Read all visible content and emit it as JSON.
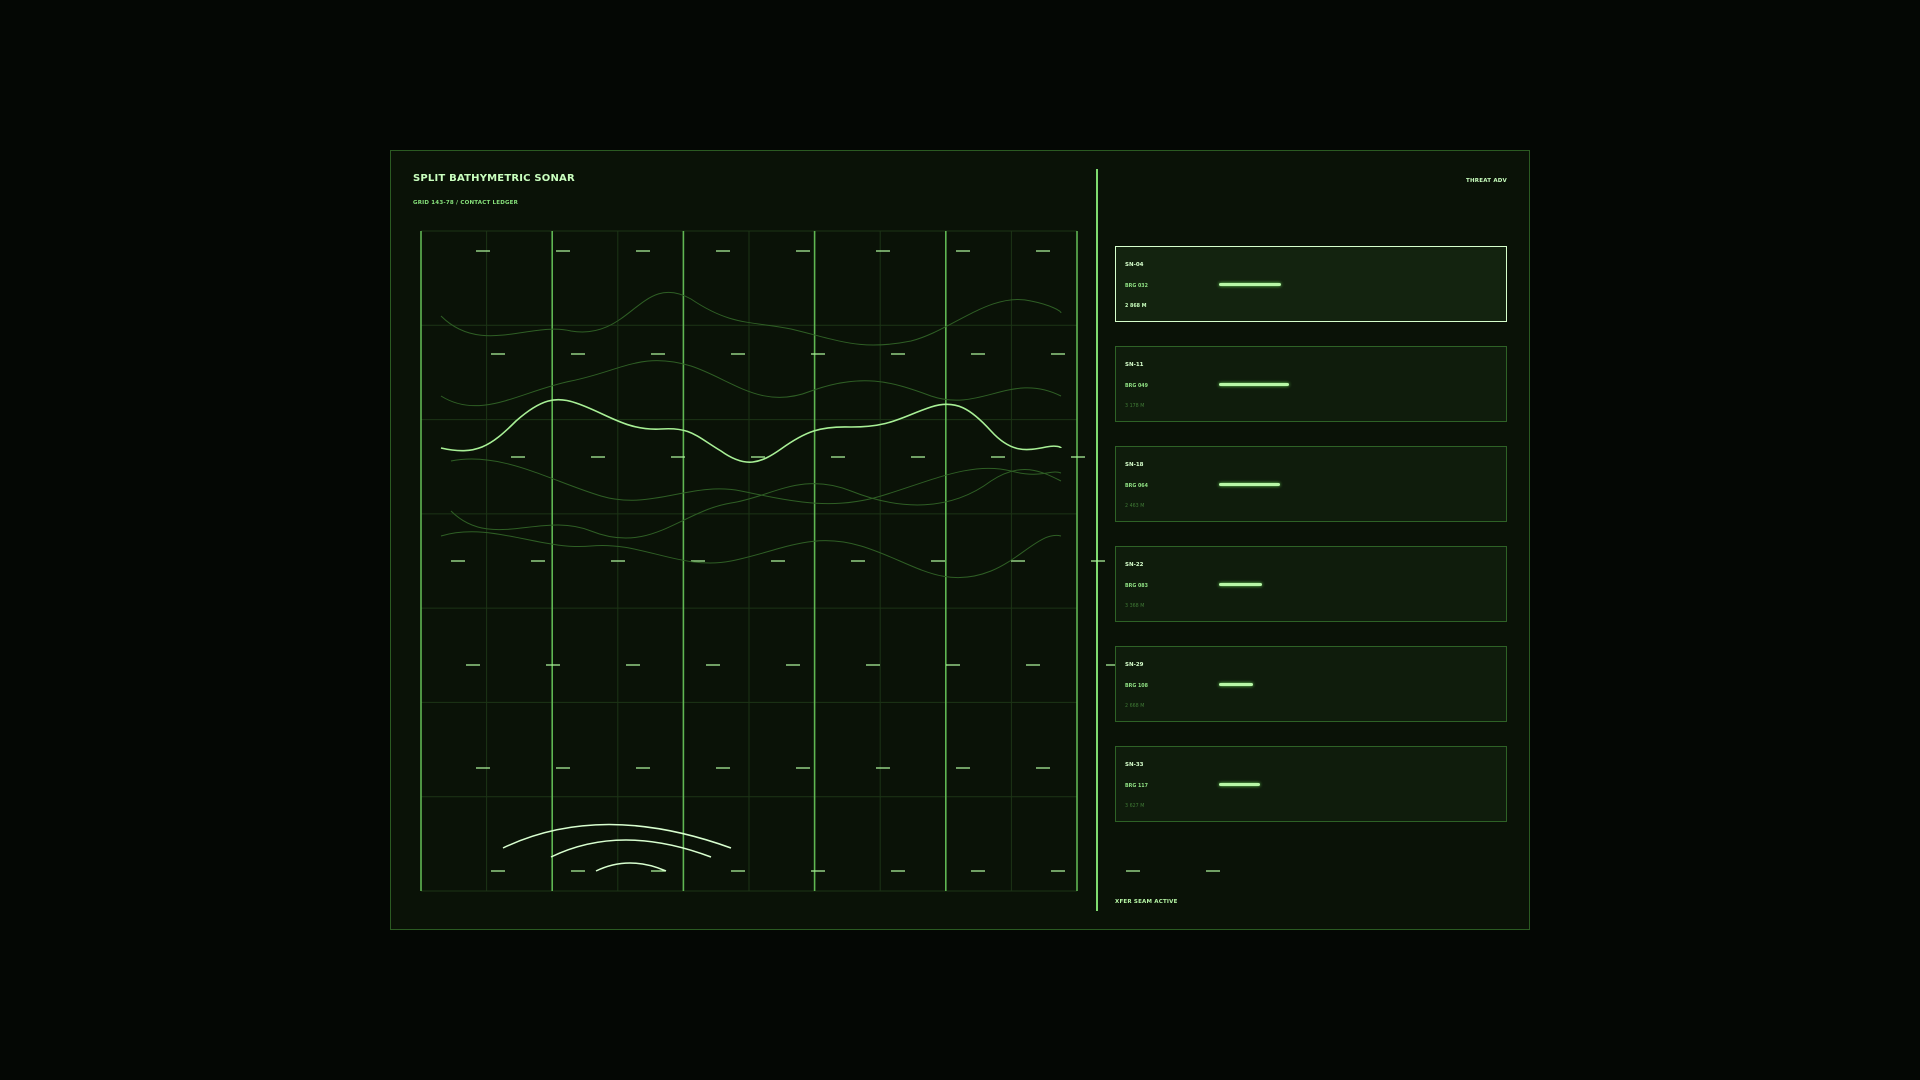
{
  "header": {
    "title": "SPLIT BATHYMETRIC SONAR",
    "subtitle": "GRID 143-78 / CONTACT LEDGER",
    "threat_label": "THREAT",
    "threat_value": "ADV"
  },
  "status": {
    "footer": "XFER SEAM ACTIVE"
  },
  "contacts": [
    {
      "id": "SN-04",
      "bearing": "BRG 032",
      "range": "2 868 M",
      "signal": 0.52,
      "selected": true
    },
    {
      "id": "SN-11",
      "bearing": "BRG 049",
      "range": "3 178 M",
      "signal": 0.58,
      "selected": false
    },
    {
      "id": "SN-18",
      "bearing": "BRG 064",
      "range": "2 463 M",
      "signal": 0.51,
      "selected": false
    },
    {
      "id": "SN-22",
      "bearing": "BRG 083",
      "range": "3 368 M",
      "signal": 0.36,
      "selected": false
    },
    {
      "id": "SN-29",
      "bearing": "BRG 108",
      "range": "2 668 M",
      "signal": 0.28,
      "selected": false
    },
    {
      "id": "SN-33",
      "bearing": "BRG 117",
      "range": "3 627 M",
      "signal": 0.34,
      "selected": false
    }
  ],
  "colors": {
    "accent": "#b7f7a6",
    "grid": "#1f3a18",
    "panel": "#0a1207",
    "border": "#2b5a22"
  }
}
